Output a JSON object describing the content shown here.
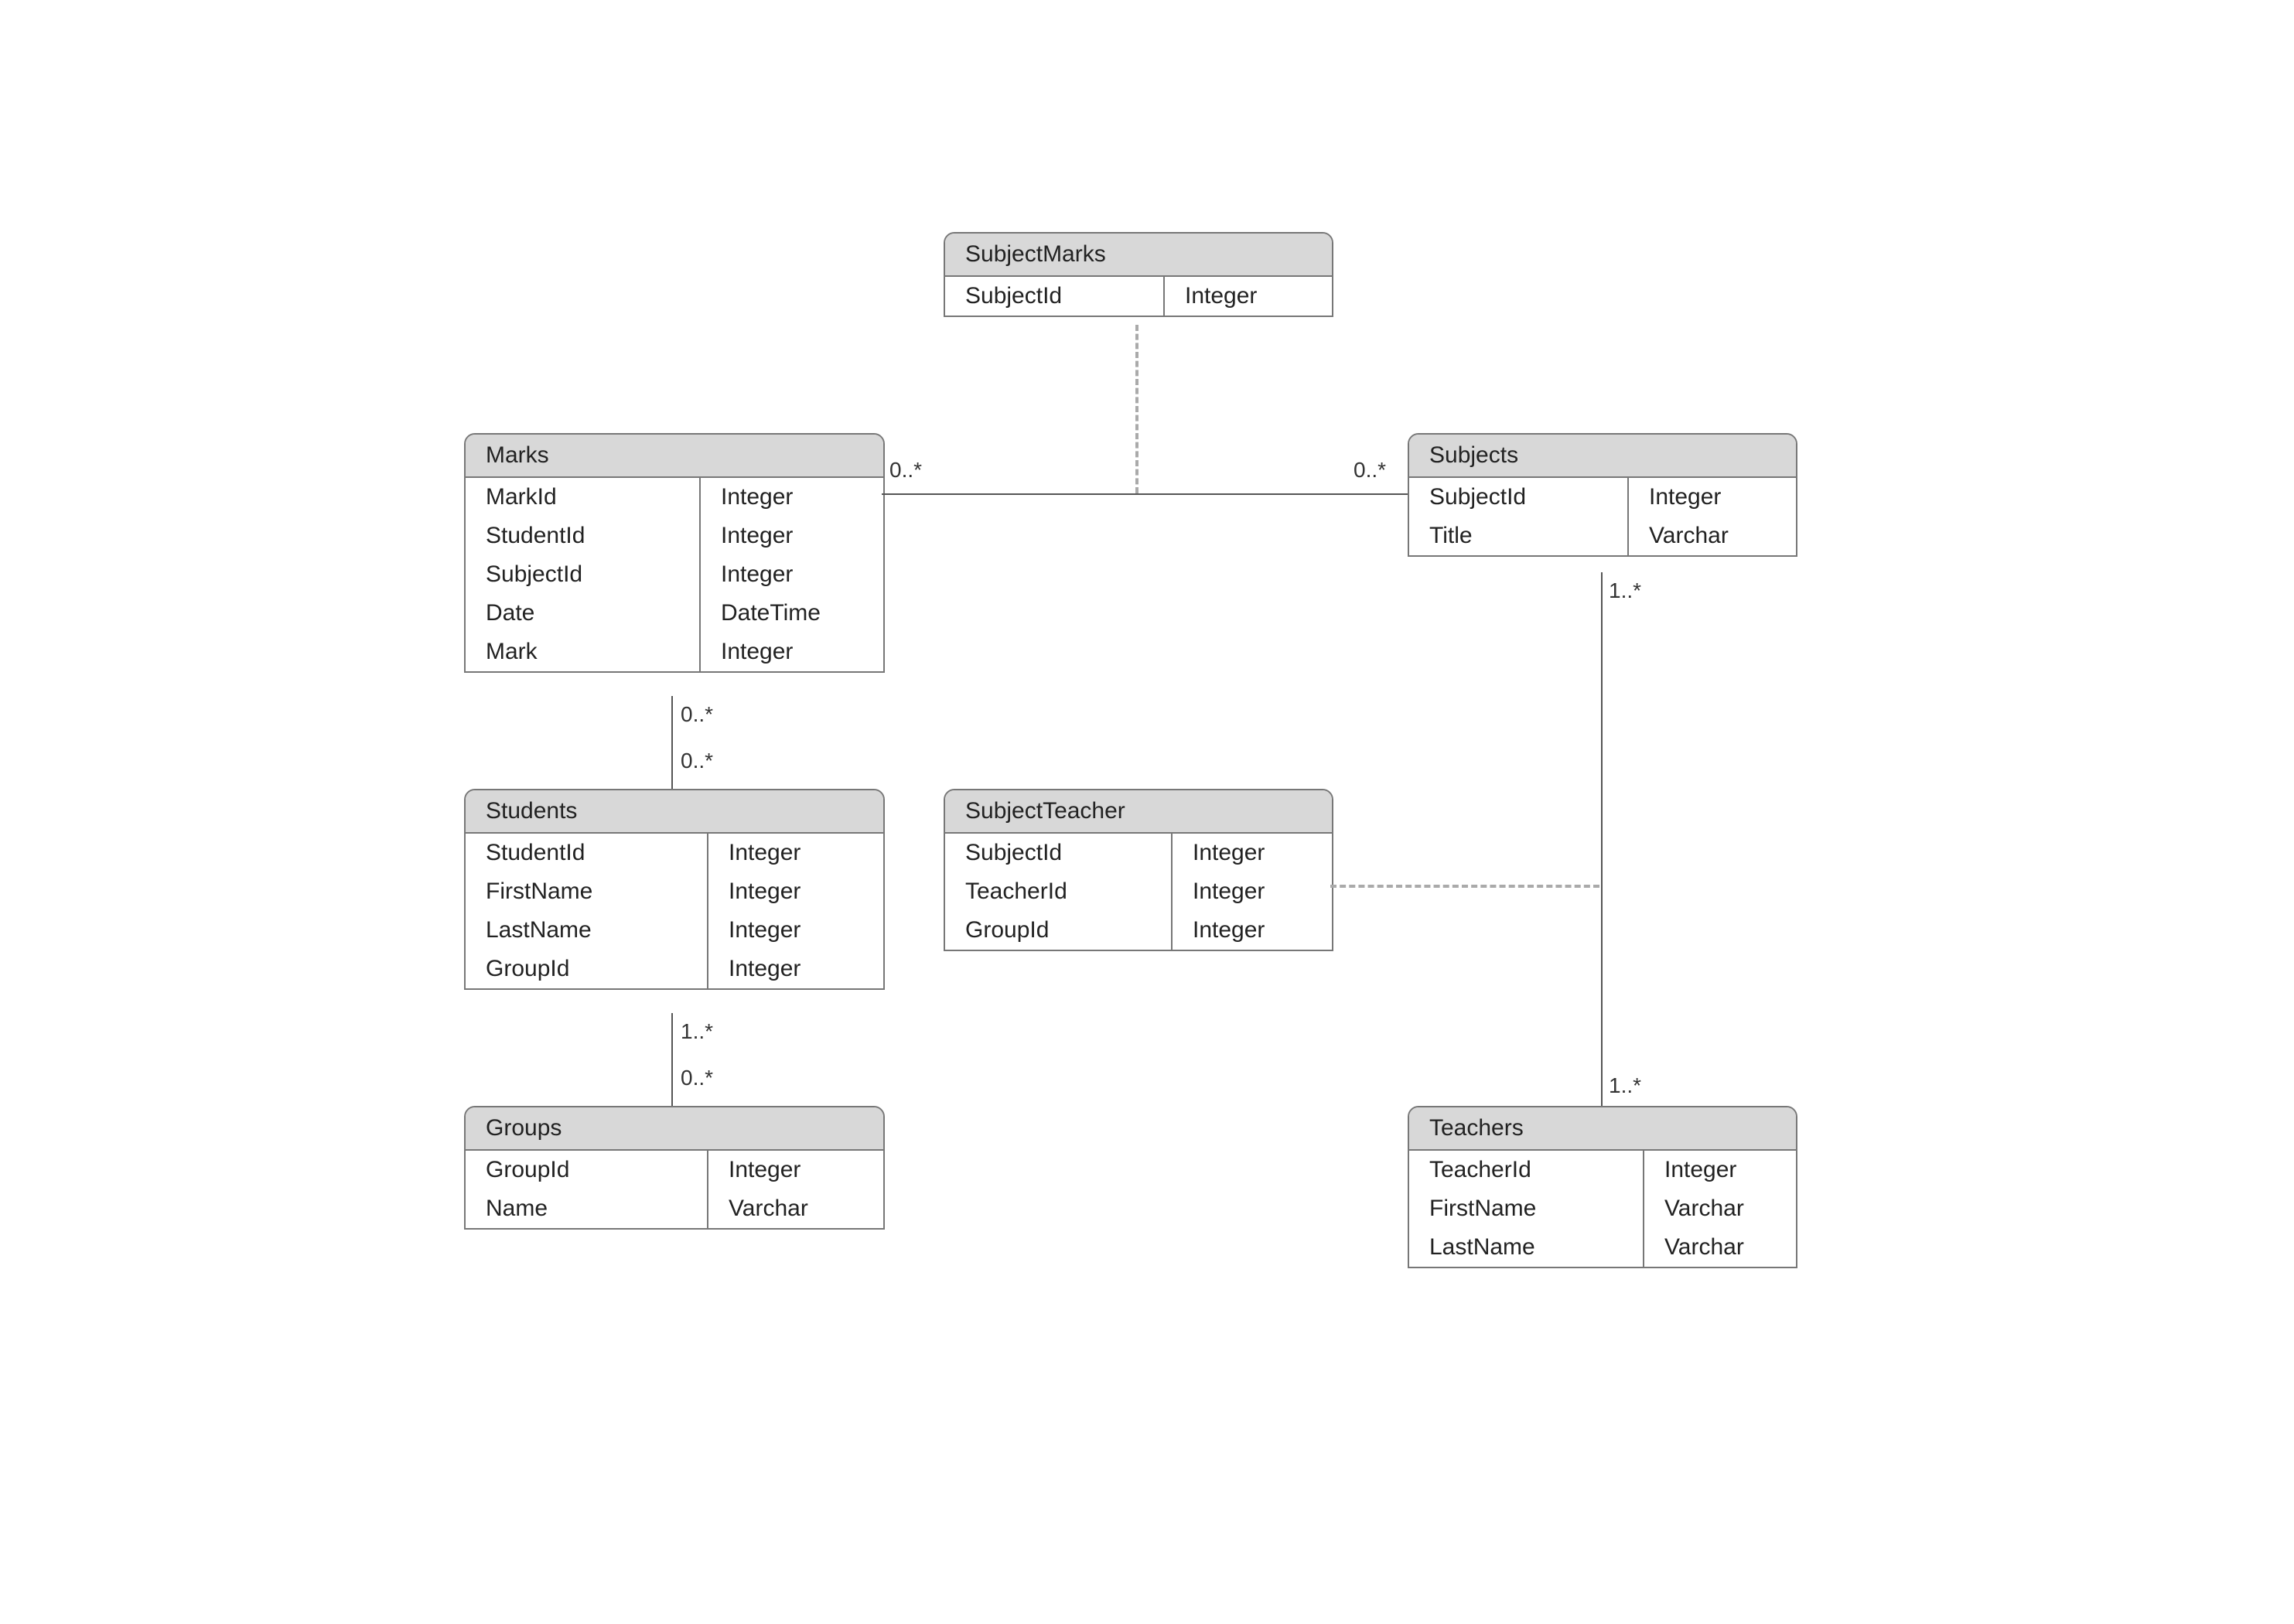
{
  "entities": {
    "subjectMarks": {
      "title": "SubjectMarks",
      "rows": [
        {
          "name": "SubjectId",
          "type": "Integer"
        }
      ]
    },
    "marks": {
      "title": "Marks",
      "rows": [
        {
          "name": "MarkId",
          "type": "Integer"
        },
        {
          "name": "StudentId",
          "type": "Integer"
        },
        {
          "name": "SubjectId",
          "type": "Integer"
        },
        {
          "name": "Date",
          "type": "DateTime"
        },
        {
          "name": "Mark",
          "type": "Integer"
        }
      ]
    },
    "subjects": {
      "title": "Subjects",
      "rows": [
        {
          "name": "SubjectId",
          "type": "Integer"
        },
        {
          "name": "Title",
          "type": "Varchar"
        }
      ]
    },
    "students": {
      "title": "Students",
      "rows": [
        {
          "name": "StudentId",
          "type": "Integer"
        },
        {
          "name": "FirstName",
          "type": "Integer"
        },
        {
          "name": "LastName",
          "type": "Integer"
        },
        {
          "name": "GroupId",
          "type": "Integer"
        }
      ]
    },
    "subjectTeacher": {
      "title": "SubjectTeacher",
      "rows": [
        {
          "name": "SubjectId",
          "type": "Integer"
        },
        {
          "name": "TeacherId",
          "type": "Integer"
        },
        {
          "name": "GroupId",
          "type": "Integer"
        }
      ]
    },
    "groups": {
      "title": "Groups",
      "rows": [
        {
          "name": "GroupId",
          "type": "Integer"
        },
        {
          "name": "Name",
          "type": "Varchar"
        }
      ]
    },
    "teachers": {
      "title": "Teachers",
      "rows": [
        {
          "name": "TeacherId",
          "type": "Integer"
        },
        {
          "name": "FirstName",
          "type": "Varchar"
        },
        {
          "name": "LastName",
          "type": "Varchar"
        }
      ]
    }
  },
  "multiplicities": {
    "marksSubjectsLeft": "0..*",
    "marksSubjectsRight": "0..*",
    "marksStudentsTop": "0..*",
    "marksStudentsBottom": "0..*",
    "subjectsTeachersTop": "1..*",
    "subjectsTeachersBottom": "1..*",
    "studentsGroupsTop": "1..*",
    "studentsGroupsBottom": "0..*"
  }
}
